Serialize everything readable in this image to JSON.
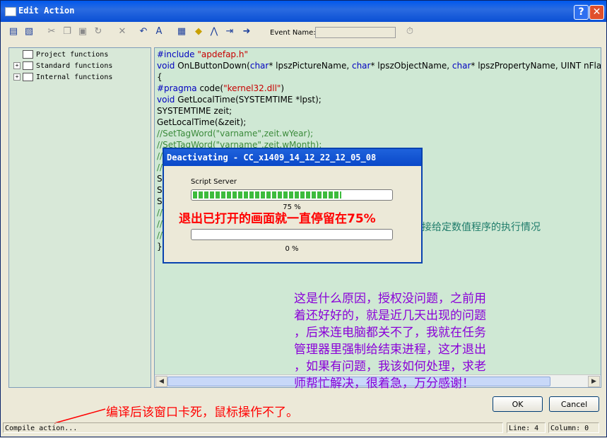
{
  "window": {
    "title": "Edit Action",
    "help_label": "?",
    "close_label": "✕"
  },
  "toolbar": {
    "event_name_label": "Event Name:",
    "event_name_value": ""
  },
  "tree": {
    "items": [
      {
        "label": "Project functions",
        "expandable": false
      },
      {
        "label": "Standard functions",
        "expandable": true
      },
      {
        "label": "Internal functions",
        "expandable": true
      }
    ]
  },
  "editor": {
    "lines": [
      {
        "parts": [
          {
            "t": "#include ",
            "c": "kw"
          },
          {
            "t": "\"apdefap.h\"",
            "c": "str"
          }
        ]
      },
      {
        "parts": [
          {
            "t": "void ",
            "c": "kw"
          },
          {
            "t": "OnLButtonDown(",
            "c": ""
          },
          {
            "t": "char",
            "c": "kw"
          },
          {
            "t": "* lpszPictureName, ",
            "c": ""
          },
          {
            "t": "char",
            "c": "kw"
          },
          {
            "t": "* lpszObjectName, ",
            "c": ""
          },
          {
            "t": "char",
            "c": "kw"
          },
          {
            "t": "* lpszPropertyName, UINT nFlag",
            "c": ""
          }
        ]
      },
      {
        "parts": [
          {
            "t": "{",
            "c": ""
          }
        ]
      },
      {
        "parts": [
          {
            "t": "#pragma ",
            "c": "kw"
          },
          {
            "t": "code(",
            "c": ""
          },
          {
            "t": "\"kernel32.dll\"",
            "c": "str"
          },
          {
            "t": ")",
            "c": ""
          }
        ]
      },
      {
        "parts": [
          {
            "t": "void ",
            "c": "kw"
          },
          {
            "t": "GetLocalTime(SYSTEMTIME *lpst);",
            "c": ""
          }
        ]
      },
      {
        "parts": [
          {
            "t": "SYSTEMTIME zeit;",
            "c": ""
          }
        ]
      },
      {
        "parts": [
          {
            "t": "GetLocalTime(&zeit);",
            "c": ""
          }
        ]
      },
      {
        "parts": [
          {
            "t": "//SetTagWord(\"varname\",zeit.wYear);",
            "c": "cm"
          }
        ]
      },
      {
        "parts": [
          {
            "t": "//SetTagWord(\"varname\",zeit.wMonth);",
            "c": "cm"
          }
        ]
      },
      {
        "parts": [
          {
            "t": "//",
            "c": "cm"
          }
        ]
      },
      {
        "parts": [
          {
            "t": "//",
            "c": "cm"
          }
        ]
      },
      {
        "parts": [
          {
            "t": "S",
            "c": ""
          }
        ]
      },
      {
        "parts": [
          {
            "t": "S",
            "c": ""
          }
        ]
      },
      {
        "parts": [
          {
            "t": "S",
            "c": ""
          }
        ]
      },
      {
        "parts": [
          {
            "t": "//",
            "c": "cm"
          }
        ]
      },
      {
        "parts": [
          {
            "t": "//",
            "c": "cm"
          }
        ]
      },
      {
        "parts": [
          {
            "t": "//",
            "c": "cm"
          }
        ]
      },
      {
        "parts": [
          {
            "t": "}",
            "c": ""
          }
        ]
      }
    ]
  },
  "dialog": {
    "title": "Deactivating - CC_x1409_14_12_22_12_05_08",
    "label": "Script Server",
    "progress1": {
      "text": "75 %",
      "value": 0.75
    },
    "progress2": {
      "text": "0 %",
      "value": 0
    }
  },
  "annotations": {
    "red_overlay": "退出已打开的画面就一直停留在75%",
    "green_overlay": "接给定数值程序的执行情况",
    "purple_lines": [
      "这是什么原因，授权没问题，之前用",
      "着还好好的，就是近几天出现的问题",
      "，后来连电脑都关不了，我就在任务",
      "管理器里强制给结束进程，这才退出",
      "，如果有问题，我该如何处理，求老",
      "师帮忙解决，很着急，万分感谢！"
    ],
    "bottom_note": "编译后该窗口卡死，鼠标操作不了。"
  },
  "buttons": {
    "ok": "OK",
    "cancel": "Cancel"
  },
  "statusbar": {
    "message": "Compile action...",
    "line": "Line: 4",
    "column": "Column: 0"
  },
  "colors": {
    "title_bar": "#0a48c8",
    "editor_bg": "#cfe8d4",
    "annotation_red": "#ff0000",
    "annotation_purple": "#8a00d8",
    "annotation_green": "#1e7c6a"
  }
}
